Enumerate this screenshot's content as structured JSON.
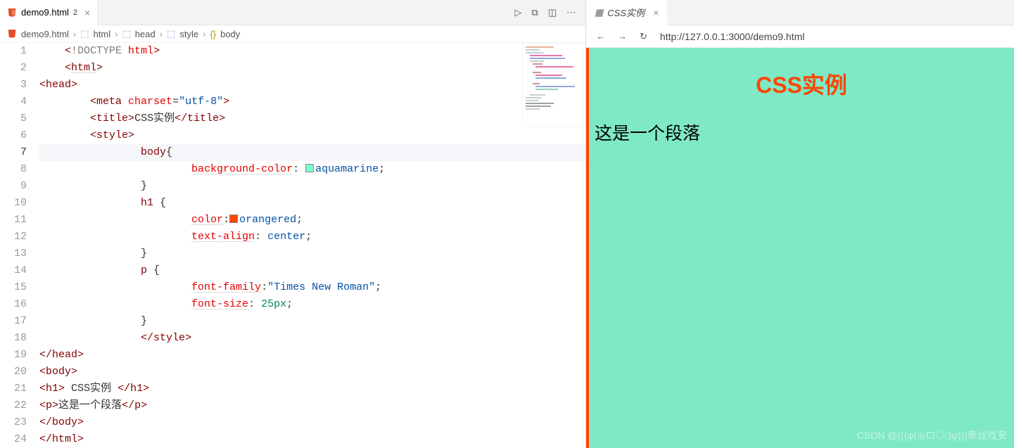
{
  "editor_tab": {
    "filename": "demo9.html",
    "dirty_badge": "2"
  },
  "breadcrumb": {
    "file": "demo9.html",
    "items": [
      "html",
      "head",
      "style",
      "body"
    ]
  },
  "toolbar_icons": {
    "run": "▷",
    "split1": "⧉",
    "split2": "◫",
    "more": "⋯"
  },
  "code_lines": [
    {
      "n": 1,
      "lead": 1,
      "segs": [
        [
          "brkt",
          "<"
        ],
        [
          "doctype",
          "!DOCTYPE "
        ],
        [
          "attr",
          "html"
        ],
        [
          "brkt",
          ">"
        ]
      ]
    },
    {
      "n": 2,
      "lead": 1,
      "segs": [
        [
          "brkt",
          "<"
        ],
        [
          "tag",
          "html"
        ],
        [
          "brkt",
          ">"
        ]
      ],
      "squiggle": true
    },
    {
      "n": 3,
      "lead": 0,
      "segs": [
        [
          "brkt",
          "<"
        ],
        [
          "tag",
          "head"
        ],
        [
          "brkt",
          ">"
        ]
      ]
    },
    {
      "n": 4,
      "lead": 2,
      "segs": [
        [
          "brkt",
          "<"
        ],
        [
          "tag",
          "meta "
        ],
        [
          "attr",
          "charset"
        ],
        [
          "punc",
          "="
        ],
        [
          "string",
          "\"utf-8\""
        ],
        [
          "brkt",
          ">"
        ]
      ]
    },
    {
      "n": 5,
      "lead": 2,
      "segs": [
        [
          "brkt",
          "<"
        ],
        [
          "tag",
          "title"
        ],
        [
          "brkt",
          ">"
        ],
        [
          "text",
          "CSS实例"
        ],
        [
          "brkt",
          "</"
        ],
        [
          "tag",
          "title"
        ],
        [
          "brkt",
          ">"
        ]
      ]
    },
    {
      "n": 6,
      "lead": 2,
      "segs": [
        [
          "brkt",
          "<"
        ],
        [
          "tag",
          "style"
        ],
        [
          "brkt",
          ">"
        ]
      ]
    },
    {
      "n": 7,
      "lead": 4,
      "segs": [
        [
          "selector",
          "body"
        ],
        [
          "brace",
          "{"
        ]
      ],
      "hl": true
    },
    {
      "n": 8,
      "lead": 6,
      "segs": [
        [
          "prop",
          "background-color"
        ],
        [
          "punc",
          ": "
        ],
        [
          "swatch",
          "aqua"
        ],
        [
          "value",
          "aquamarine"
        ],
        [
          "punc",
          ";"
        ]
      ],
      "sqprop": true
    },
    {
      "n": 9,
      "lead": 4,
      "segs": [
        [
          "brace",
          "}"
        ]
      ]
    },
    {
      "n": 10,
      "lead": 4,
      "segs": [
        [
          "selector",
          "h1 "
        ],
        [
          "brace",
          "{"
        ]
      ]
    },
    {
      "n": 11,
      "lead": 6,
      "segs": [
        [
          "prop",
          "color"
        ],
        [
          "punc",
          ":"
        ],
        [
          "swatch",
          "or"
        ],
        [
          "value",
          "orangered"
        ],
        [
          "punc",
          ";"
        ]
      ],
      "sqprop": true
    },
    {
      "n": 12,
      "lead": 6,
      "segs": [
        [
          "prop",
          "text-align"
        ],
        [
          "punc",
          ": "
        ],
        [
          "value",
          "center"
        ],
        [
          "punc",
          ";"
        ]
      ],
      "sqprop": true
    },
    {
      "n": 13,
      "lead": 4,
      "segs": [
        [
          "brace",
          "}"
        ]
      ]
    },
    {
      "n": 14,
      "lead": 4,
      "segs": [
        [
          "selector",
          "p "
        ],
        [
          "brace",
          "{"
        ]
      ]
    },
    {
      "n": 15,
      "lead": 6,
      "segs": [
        [
          "prop",
          "font-family"
        ],
        [
          "punc",
          ":"
        ],
        [
          "string",
          "\"Times New Roman\""
        ],
        [
          "punc",
          ";"
        ]
      ],
      "sqprop": true
    },
    {
      "n": 16,
      "lead": 6,
      "segs": [
        [
          "prop",
          "font-size"
        ],
        [
          "punc",
          ": "
        ],
        [
          "unit",
          "25px"
        ],
        [
          "punc",
          ";"
        ]
      ],
      "sqprop": true
    },
    {
      "n": 17,
      "lead": 4,
      "segs": [
        [
          "brace",
          "}"
        ]
      ]
    },
    {
      "n": 18,
      "lead": 4,
      "segs": [
        [
          "brkt",
          "</"
        ],
        [
          "tag",
          "style"
        ],
        [
          "brkt",
          ">"
        ]
      ]
    },
    {
      "n": 19,
      "lead": 0,
      "segs": [
        [
          "brkt",
          "</"
        ],
        [
          "tag",
          "head"
        ],
        [
          "brkt",
          ">"
        ]
      ]
    },
    {
      "n": 20,
      "lead": 0,
      "segs": [
        [
          "brkt",
          "<"
        ],
        [
          "tag",
          "body"
        ],
        [
          "brkt",
          ">"
        ]
      ]
    },
    {
      "n": 21,
      "lead": 0,
      "segs": [
        [
          "brkt",
          "<"
        ],
        [
          "tag",
          "h1"
        ],
        [
          "brkt",
          ">"
        ],
        [
          "text",
          " CSS实例 "
        ],
        [
          "brkt",
          "</"
        ],
        [
          "tag",
          "h1"
        ],
        [
          "brkt",
          ">"
        ]
      ]
    },
    {
      "n": 22,
      "lead": 0,
      "segs": [
        [
          "brkt",
          "<"
        ],
        [
          "tag",
          "p"
        ],
        [
          "brkt",
          ">"
        ],
        [
          "text",
          "这是一个段落"
        ],
        [
          "brkt",
          "</"
        ],
        [
          "tag",
          "p"
        ],
        [
          "brkt",
          ">"
        ]
      ]
    },
    {
      "n": 23,
      "lead": 0,
      "segs": [
        [
          "brkt",
          "</"
        ],
        [
          "tag",
          "body"
        ],
        [
          "brkt",
          ">"
        ]
      ]
    },
    {
      "n": 24,
      "lead": 0,
      "segs": [
        [
          "brkt",
          "</"
        ],
        [
          "tag",
          "html"
        ],
        [
          "brkt",
          ">"
        ]
      ]
    }
  ],
  "preview_tab": {
    "title": "CSS实例"
  },
  "preview_nav": {
    "back": "←",
    "forward": "→",
    "reload": "↻",
    "url": "http://127.0.0.1:3000/demo9.html"
  },
  "preview_content": {
    "h1": "CSS实例",
    "p": "这是一个段落"
  },
  "watermark": "CSDN @(((φ(◎ロ◎;)φ)))牵丝戏安"
}
